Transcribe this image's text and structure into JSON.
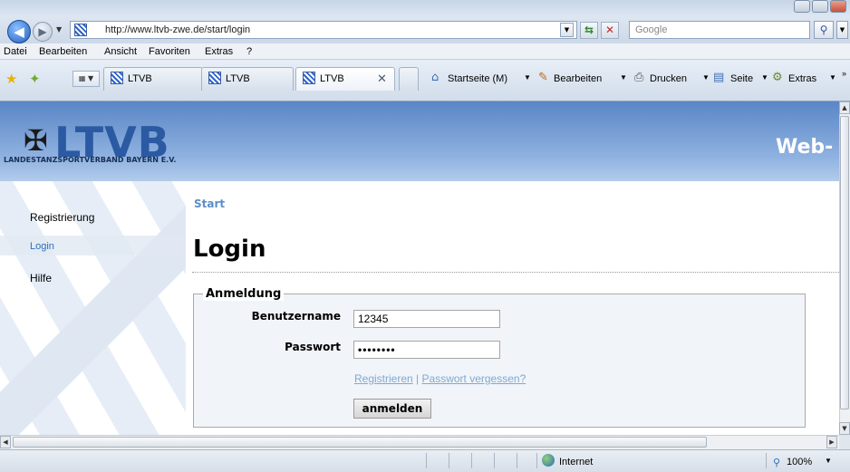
{
  "browser": {
    "url": "http://www.ltvb-zwe.de/start/login",
    "search_placeholder": "Google",
    "menu": [
      "Datei",
      "Bearbeiten",
      "Ansicht",
      "Favoriten",
      "Extras",
      "?"
    ],
    "tabs": [
      {
        "label": "LTVB",
        "active": false
      },
      {
        "label": "LTVB",
        "active": false
      },
      {
        "label": "LTVB",
        "active": true
      }
    ],
    "commands": {
      "home": "Startseite (M)",
      "edit": "Bearbeiten",
      "print": "Drucken",
      "page": "Seite",
      "tools": "Extras"
    },
    "status": {
      "zone": "Internet",
      "zoom": "100%"
    }
  },
  "site": {
    "logo_text": "LTVB",
    "logo_subtitle": "LANDESTANZSPORTVERBAND BAYERN E.V.",
    "header_right": "Web-"
  },
  "sidebar": {
    "items": [
      {
        "label": "Registrierung",
        "active": false
      },
      {
        "label": "Login",
        "active": true
      },
      {
        "label": "Hilfe",
        "active": false
      }
    ]
  },
  "main": {
    "breadcrumb": "Start",
    "title": "Login",
    "form": {
      "legend": "Anmeldung",
      "username_label": "Benutzername",
      "username_value": "12345",
      "password_label": "Passwort",
      "password_value": "••••••••",
      "register_link": "Registrieren",
      "separator": "|",
      "forgot_link": "Passwort vergessen?",
      "submit_label": "anmelden"
    }
  },
  "colors": {
    "header_blue": "#5a86c6",
    "link_blue": "#7da9d6",
    "breadcrumb_blue": "#5b8fc4"
  }
}
